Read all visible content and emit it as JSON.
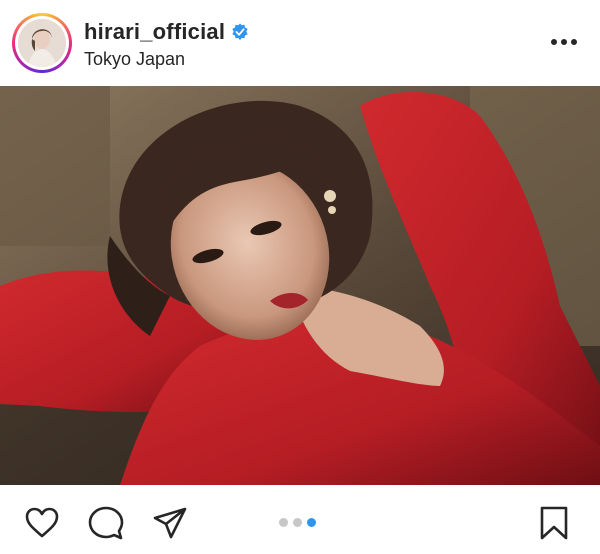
{
  "post": {
    "username": "hirari_official",
    "verified": true,
    "location": "Tokyo Japan"
  },
  "media": {
    "carousel_total": 3,
    "carousel_active_index": 2
  },
  "actions": {
    "icons": [
      "heart-icon",
      "comment-icon",
      "share-icon",
      "bookmark-icon"
    ]
  },
  "colors": {
    "text": "#262626",
    "accent_blue": "#2f95f1",
    "dot_inactive": "#c7c7c7",
    "dress_red": "#c4202a"
  }
}
